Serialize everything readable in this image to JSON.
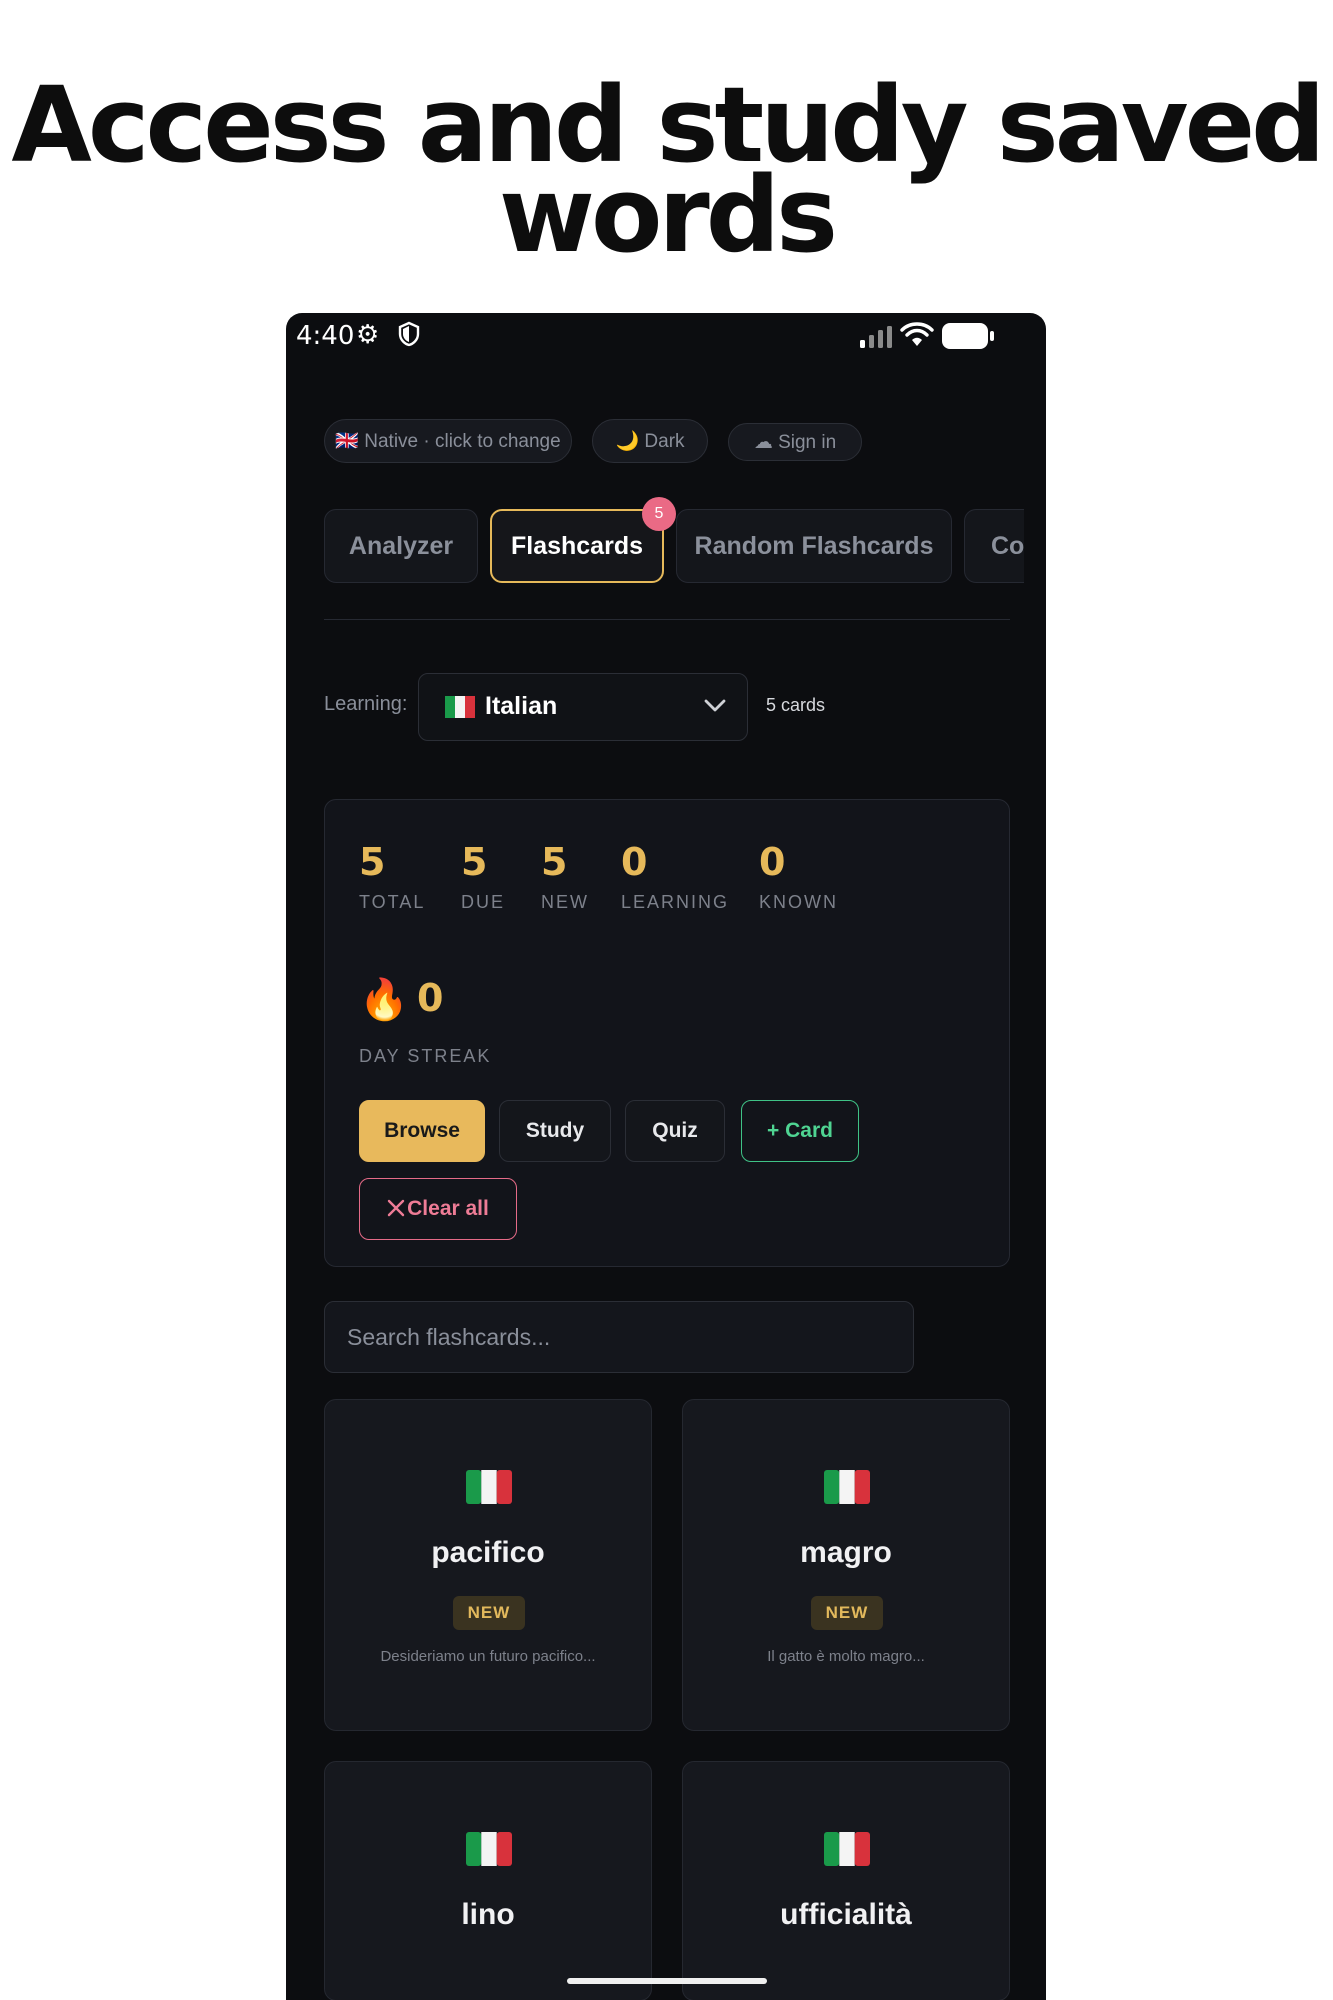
{
  "headline": {
    "line1": "Access and study saved",
    "line2": "words"
  },
  "status_bar": {
    "time": "4:40"
  },
  "top_chips": {
    "native": "🇬🇧 Native · click to change",
    "theme": "🌙 Dark",
    "sign_in": "☁ Sign in"
  },
  "tabs": [
    {
      "label": "Analyzer"
    },
    {
      "label": "Flashcards",
      "active": true,
      "badge": "5"
    },
    {
      "label": "Random Flashcards"
    },
    {
      "label": "Co"
    }
  ],
  "learning": {
    "label": "Learning:",
    "language": "Italian",
    "flag": "🇮🇹",
    "cards_count": "5 cards"
  },
  "stats": [
    {
      "value": "5",
      "label": "TOTAL"
    },
    {
      "value": "5",
      "label": "DUE"
    },
    {
      "value": "5",
      "label": "NEW"
    },
    {
      "value": "0",
      "label": "LEARNING"
    },
    {
      "value": "0",
      "label": "KNOWN"
    }
  ],
  "streak": {
    "icon": "🔥",
    "value": "0",
    "label": "DAY STREAK"
  },
  "actions": {
    "browse": "Browse",
    "study": "Study",
    "quiz": "Quiz",
    "add_card": "+ Card",
    "clear_all": "Clear all"
  },
  "search": {
    "placeholder": "Search flashcards..."
  },
  "flashcards": [
    {
      "word": "pacifico",
      "status": "NEW",
      "example": "Desideriamo un futuro pacifico..."
    },
    {
      "word": "magro",
      "status": "NEW",
      "example": "Il gatto è molto magro..."
    },
    {
      "word": "lino"
    },
    {
      "word": "ufficialità"
    }
  ],
  "colors": {
    "accent": "#e6b95a",
    "badge": "#ea6a85",
    "green": "#3fc286",
    "red": "#e56b88",
    "background": "#0c0d10"
  }
}
